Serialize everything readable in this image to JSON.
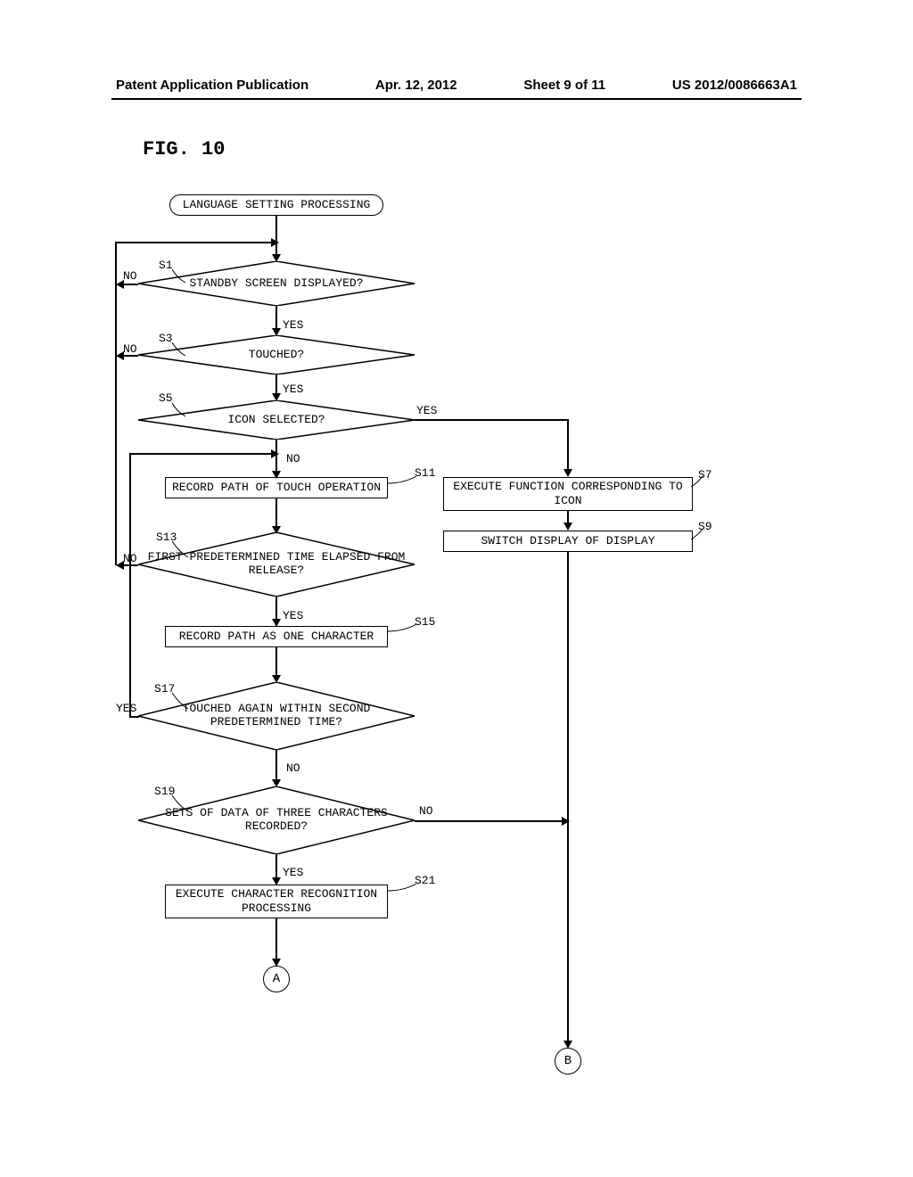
{
  "header": {
    "pub_type": "Patent Application Publication",
    "date": "Apr. 12, 2012",
    "sheet": "Sheet 9 of 11",
    "pub_number": "US 2012/0086663A1"
  },
  "figure": {
    "label": "FIG. 10",
    "start": "LANGUAGE SETTING PROCESSING",
    "s1": {
      "id": "S1",
      "text": "STANDBY SCREEN DISPLAYED?",
      "no": "NO",
      "yes": "YES"
    },
    "s3": {
      "id": "S3",
      "text": "TOUCHED?",
      "no": "NO",
      "yes": "YES"
    },
    "s5": {
      "id": "S5",
      "text": "ICON SELECTED?",
      "no": "NO",
      "yes": "YES"
    },
    "s7": {
      "id": "S7",
      "text": "EXECUTE FUNCTION CORRESPONDING TO ICON"
    },
    "s9": {
      "id": "S9",
      "text": "SWITCH DISPLAY OF DISPLAY"
    },
    "s11": {
      "id": "S11",
      "text": "RECORD PATH OF TOUCH OPERATION"
    },
    "s13": {
      "id": "S13",
      "text": "FIRST PREDETERMINED TIME ELAPSED FROM RELEASE?",
      "no": "NO",
      "yes": "YES"
    },
    "s15": {
      "id": "S15",
      "text": "RECORD PATH AS ONE CHARACTER"
    },
    "s17": {
      "id": "S17",
      "text": "TOUCHED AGAIN WITHIN SECOND PREDETERMINED TIME?",
      "no": "NO",
      "yes": "YES"
    },
    "s19": {
      "id": "S19",
      "text": "SETS OF DATA OF THREE CHARACTERS RECORDED?",
      "no": "NO",
      "yes": "YES"
    },
    "s21": {
      "id": "S21",
      "text": "EXECUTE CHARACTER RECOGNITION PROCESSING"
    },
    "connectors": {
      "a": "A",
      "b": "B"
    }
  }
}
